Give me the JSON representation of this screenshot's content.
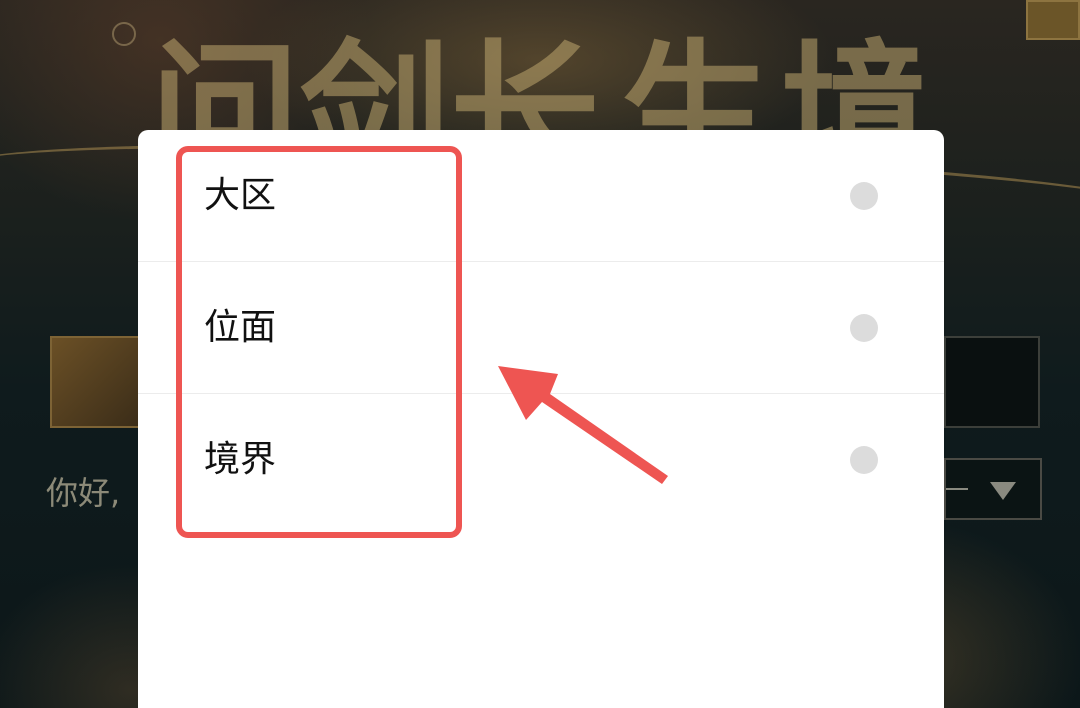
{
  "background": {
    "title_glyphs": [
      "问",
      "剑",
      "长",
      "生",
      "境"
    ],
    "greeting": "你好,"
  },
  "sheet": {
    "options": [
      {
        "label": "大区"
      },
      {
        "label": "位面"
      },
      {
        "label": "境界"
      }
    ]
  },
  "colors": {
    "annotation_red": "#ee5552",
    "radio_gray": "#dcdcdc",
    "sheet_bg": "#ffffff",
    "divider": "#ececec"
  }
}
